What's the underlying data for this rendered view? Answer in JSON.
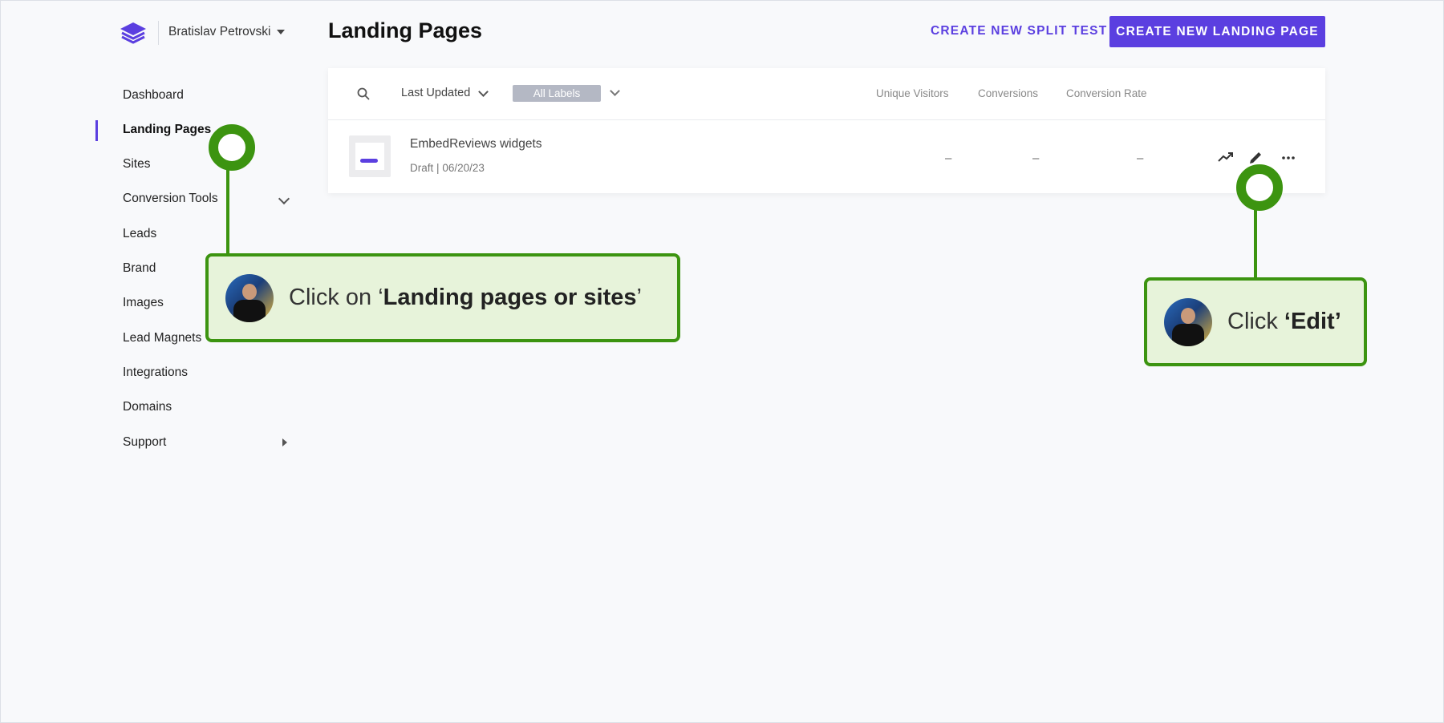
{
  "header": {
    "account_name": "Bratislav Petrovski",
    "page_title": "Landing Pages",
    "split_test_label": "CREATE NEW SPLIT TEST",
    "create_label": "CREATE NEW LANDING PAGE"
  },
  "sidebar": {
    "items": [
      {
        "label": "Dashboard"
      },
      {
        "label": "Landing Pages",
        "active": true
      },
      {
        "label": "Sites"
      },
      {
        "label": "Conversion Tools",
        "expandable": "chevron-down-icon"
      },
      {
        "label": "Leads"
      },
      {
        "label": "Brand"
      },
      {
        "label": "Images"
      },
      {
        "label": "Lead Magnets"
      },
      {
        "label": "Integrations"
      },
      {
        "label": "Domains"
      },
      {
        "label": "Support",
        "expandable": "triangle-right-icon"
      }
    ]
  },
  "table": {
    "sort_label": "Last Updated",
    "labels_filter": "All Labels",
    "columns": [
      "Unique Visitors",
      "Conversions",
      "Conversion Rate"
    ],
    "rows": [
      {
        "name": "EmbedReviews widgets",
        "status": "Draft",
        "separator": "|",
        "date": "06/20/23",
        "unique_visitors": "–",
        "conversions": "–",
        "conversion_rate": "–",
        "actions": [
          "trending-up-icon",
          "pencil-edit-icon",
          "more-dots-icon"
        ]
      }
    ]
  },
  "callouts": {
    "landing": {
      "prefix": "Click on ‘",
      "bold": "Landing pages or sites",
      "suffix": "’"
    },
    "edit": {
      "prefix": "Click ",
      "bold": "‘Edit’",
      "suffix": ""
    }
  },
  "colors": {
    "accent": "#5b3fe0",
    "callout_border": "#3c9410",
    "callout_fill": "#e7f3da",
    "background": "#f8f9fb"
  }
}
